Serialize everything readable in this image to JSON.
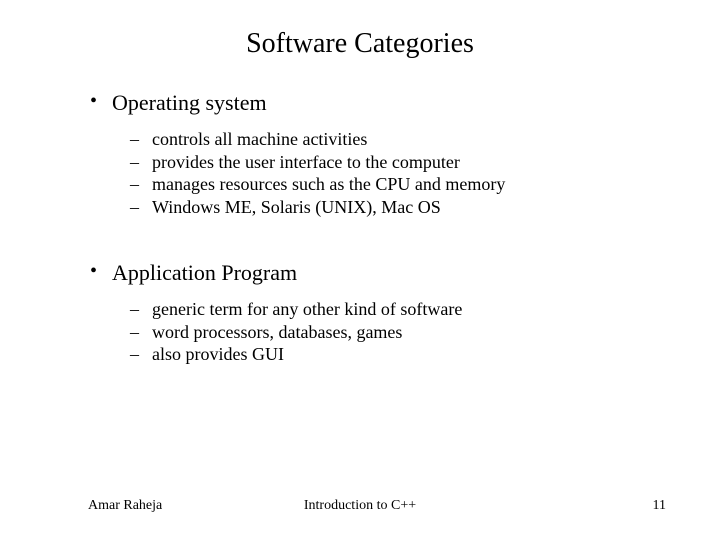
{
  "title": "Software Categories",
  "bullets": [
    {
      "label": "Operating system",
      "sub": [
        "controls all machine activities",
        "provides the user interface to the computer",
        "manages resources such as the CPU and memory",
        "Windows ME, Solaris (UNIX), Mac OS"
      ]
    },
    {
      "label": "Application Program",
      "sub": [
        "generic term for any other kind of software",
        "word processors, databases, games",
        "also provides GUI"
      ]
    }
  ],
  "footer": {
    "left": "Amar Raheja",
    "center": "Introduction to C++",
    "right": "11"
  }
}
